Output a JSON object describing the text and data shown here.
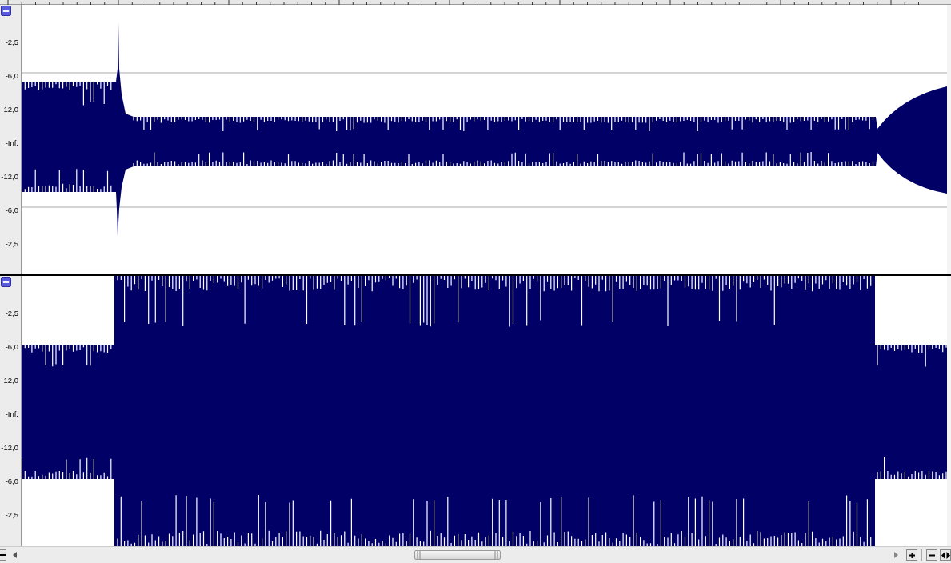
{
  "tracks": [
    {
      "axis_labels": [
        "-2,5",
        "-6,0",
        "-12,0",
        "-Inf.",
        "-12,0",
        "-6,0",
        "-2,5"
      ]
    },
    {
      "axis_labels": [
        "-2,5",
        "-6,0",
        "-12,0",
        "-Inf.",
        "-12,0",
        "-6,0",
        "-2,5"
      ]
    }
  ]
}
